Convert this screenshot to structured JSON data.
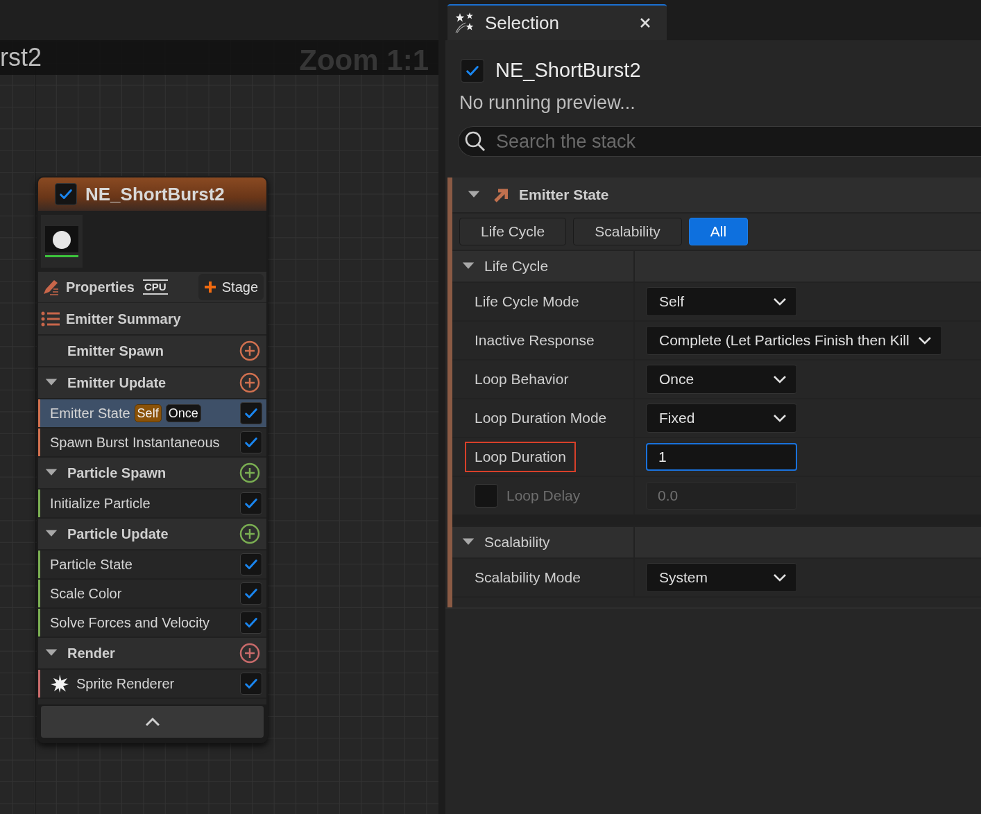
{
  "graph": {
    "title_fragment": "rst2",
    "zoom": "Zoom 1:1"
  },
  "node": {
    "title": "NE_ShortBurst2",
    "enabled": true,
    "properties_label": "Properties",
    "sim_target": "CPU",
    "stage_button": "Stage",
    "summary": "Emitter Summary",
    "groups": [
      {
        "label": "Emitter Spawn",
        "color": "#d0704f"
      },
      {
        "label": "Emitter Update",
        "color": "#d0704f",
        "modules": [
          {
            "label": "Emitter State",
            "kind": "module",
            "checked": true,
            "selected": true,
            "badges": [
              {
                "text": "Self",
                "kind": "mode"
              },
              {
                "text": "Once",
                "kind": "loop"
              }
            ]
          },
          {
            "label": "Spawn Burst Instantaneous",
            "kind": "module",
            "checked": true,
            "selected": false
          }
        ]
      },
      {
        "label": "Particle Spawn",
        "color": "#7aae52",
        "modules": [
          {
            "label": "Initialize Particle",
            "kind": "module",
            "checked": true,
            "selected": false
          }
        ]
      },
      {
        "label": "Particle Update",
        "color": "#7aae52",
        "modules": [
          {
            "label": "Particle State",
            "kind": "module",
            "checked": true,
            "selected": false
          },
          {
            "label": "Scale Color",
            "kind": "module",
            "checked": true,
            "selected": false
          },
          {
            "label": "Solve Forces and Velocity",
            "kind": "module",
            "checked": true,
            "selected": false
          }
        ]
      },
      {
        "label": "Render",
        "color": "#c86a6a",
        "modules": [
          {
            "label": "Sprite Renderer",
            "kind": "renderer",
            "checked": true,
            "selected": false
          }
        ]
      }
    ]
  },
  "panel": {
    "tab": {
      "label": "Selection"
    },
    "emitter": {
      "name": "NE_ShortBurst2",
      "enabled": true
    },
    "status": "No running preview...",
    "search": {
      "placeholder": "Search the stack"
    },
    "section": {
      "title": "Emitter State",
      "filter_tabs": [
        {
          "label": "Life Cycle",
          "selected": false
        },
        {
          "label": "Scalability",
          "selected": false
        },
        {
          "label": "All",
          "selected": true
        }
      ],
      "categories": [
        {
          "label": "Life Cycle",
          "expanded": true,
          "properties": [
            {
              "label": "Life Cycle Mode",
              "kind": "dropdown",
              "value": "Self"
            },
            {
              "label": "Inactive Response",
              "kind": "dropdown",
              "value": "Complete (Let Particles Finish then Kill"
            },
            {
              "label": "Loop Behavior",
              "kind": "dropdown",
              "value": "Once"
            },
            {
              "label": "Loop Duration Mode",
              "kind": "dropdown",
              "value": "Fixed"
            },
            {
              "label": "Loop Duration",
              "kind": "number",
              "value": "1",
              "focused": true,
              "highlighted": true
            },
            {
              "label": "Loop Delay",
              "kind": "toggled_number",
              "value": "0.0",
              "enabled": false
            }
          ]
        },
        {
          "label": "Scalability",
          "expanded": true,
          "properties": [
            {
              "label": "Scalability Mode",
              "kind": "dropdown",
              "value": "System"
            }
          ]
        }
      ]
    }
  }
}
